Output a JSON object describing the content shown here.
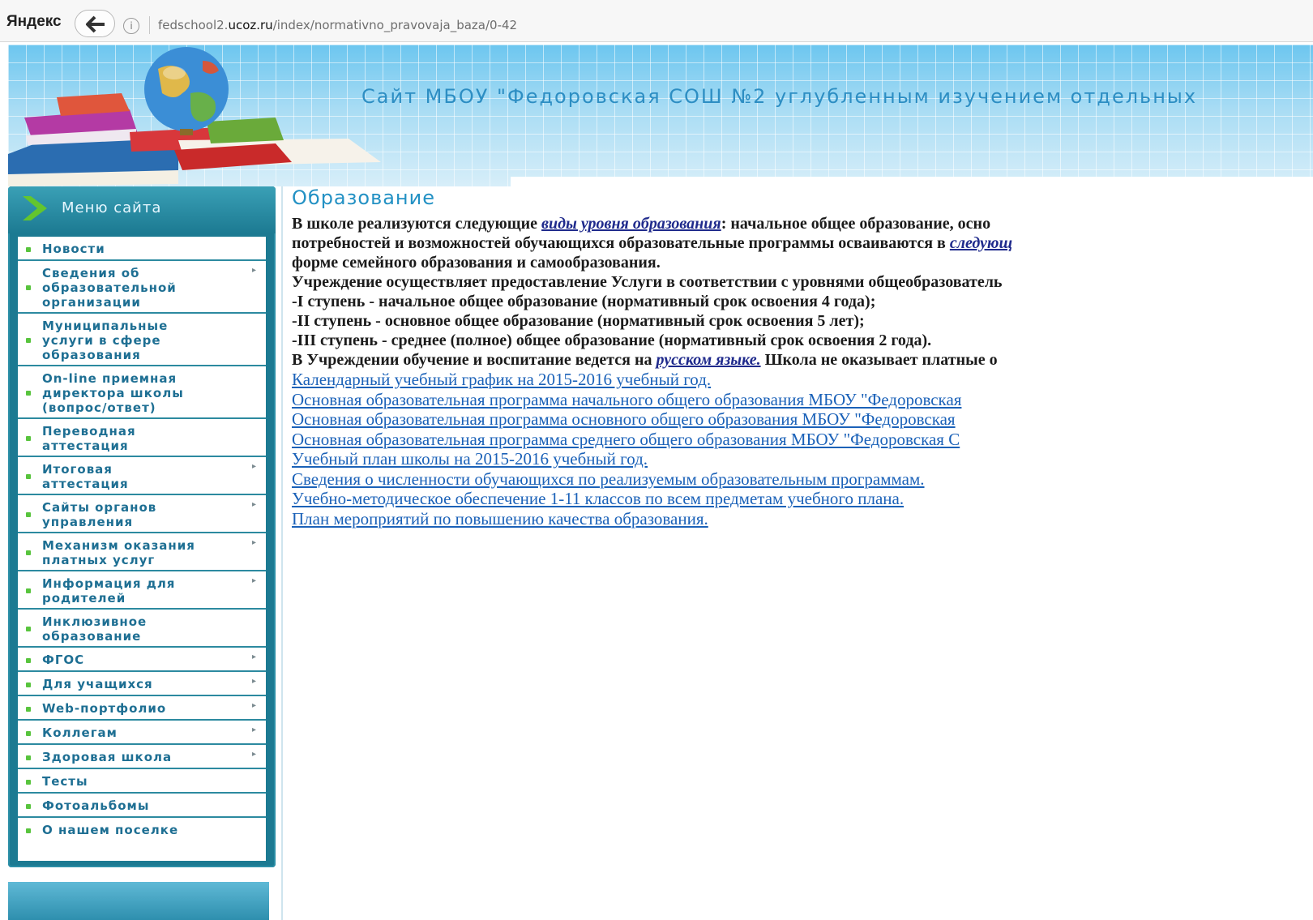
{
  "browser": {
    "brand": "Яндекс",
    "url_prefix": "fedschool2.",
    "url_domain": "ucoz.ru",
    "url_path": "/index/normativno_pravovaja_baza/0-42"
  },
  "header": {
    "title": "Сайт МБОУ \"Федоровская СОШ №2 углубленным изучением отдельных"
  },
  "sidebar": {
    "menu_title": "Меню сайта",
    "items": [
      {
        "label": "Новости",
        "arrow": ""
      },
      {
        "label": "Сведения об\nобразовательной\nорганизации",
        "arrow": "▸"
      },
      {
        "label": "Муниципальные\nуслуги в сфере\nобразования",
        "arrow": ""
      },
      {
        "label": "On-line приемная\nдиректора школы\n(вопрос/ответ)",
        "arrow": ""
      },
      {
        "label": "Переводная\nаттестация",
        "arrow": ""
      },
      {
        "label": "Итоговая\nаттестация",
        "arrow": "▸"
      },
      {
        "label": "Сайты органов\nуправления",
        "arrow": "▸"
      },
      {
        "label": "Механизм оказания\nплатных услуг",
        "arrow": "▸"
      },
      {
        "label": "Информация для\nродителей",
        "arrow": "▸"
      },
      {
        "label": "Инклюзивное\nобразование",
        "arrow": ""
      },
      {
        "label": "ФГОС",
        "arrow": "▸"
      },
      {
        "label": "Для учащихся",
        "arrow": "▸"
      },
      {
        "label": "Web-портфолио",
        "arrow": "▸"
      },
      {
        "label": "Коллегам",
        "arrow": "▸"
      },
      {
        "label": "Здоровая школа",
        "arrow": "▸"
      },
      {
        "label": "Тесты",
        "arrow": ""
      },
      {
        "label": "Фотоальбомы",
        "arrow": ""
      },
      {
        "label": "О нашем поселке",
        "arrow": ""
      }
    ]
  },
  "main": {
    "heading": "Образование",
    "p1_a": " В школе реализуются следующие ",
    "p1_em": "виды уровня образования",
    "p1_b": ": начальное общее образование, осно",
    "p2_a": "потребностей и возможностей обучающихся образовательные программы осваиваются в ",
    "p2_em": "следующ",
    "p3": "форме семейного образования и самообразования.",
    "p4": "Учреждение осуществляет предоставление Услуги в соответствии с уровнями общеобразователь",
    "p5": "-I ступень - начальное общее образование (нормативный срок освоения 4 года);",
    "p6": "-II ступень - основное общее образование (нормативный срок освоения 5 лет);",
    "p7": "-III ступень - среднее (полное) общее образование (нормативный срок освоения 2 года).",
    "p8_a": "В Учреждении обучение и воспитание ведется на ",
    "p8_em": "русском языке.",
    "p8_b": " Школа не оказывает платные о",
    "links": [
      "Календарный учебный график на 2015-2016 учебный год.",
      "Основная образовательная программа начального общего образования МБОУ \"Федоровская",
      "Основная образовательная программа основного общего образования МБОУ \"Федоровская",
      "Основная образовательная программа среднего общего образования МБОУ \"Федоровская С",
      "Учебный план школы на 2015-2016 учебный год.",
      "Сведения о численности обучающихся по реализуемым образовательным программам.",
      "Учебно-методическое обеспечение 1-11 классов по всем предметам учебного плана.",
      "План мероприятий по повышению качества образования."
    ]
  }
}
